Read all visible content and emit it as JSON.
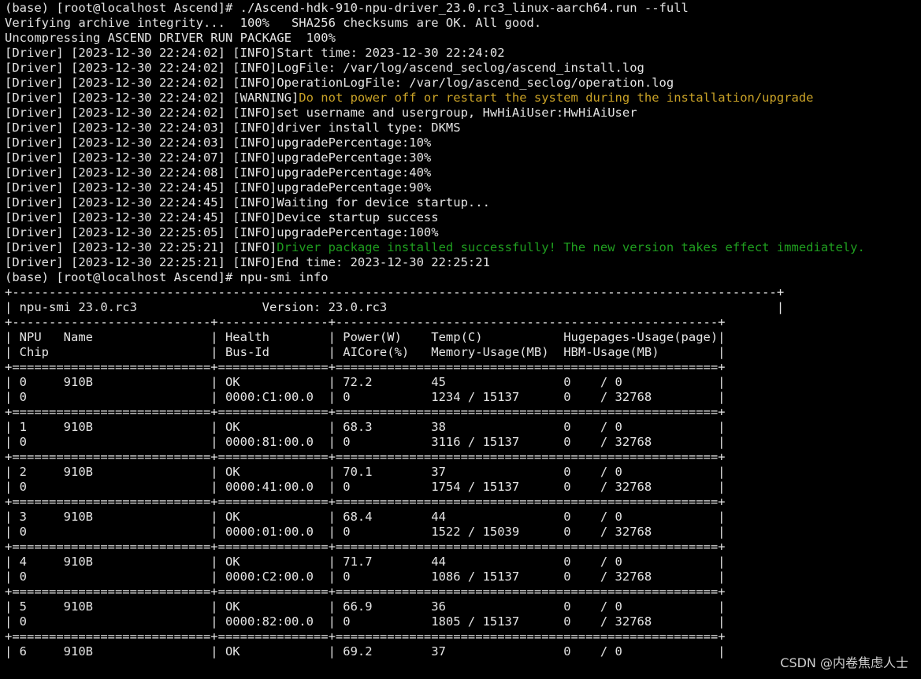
{
  "terminal": {
    "background": "#000000",
    "foreground": "#e4e4e4",
    "warning_color": "#c9a227",
    "success_color": "#1f9e1f",
    "lines": [
      {
        "segments": [
          {
            "text": "(base) [root@localhost Ascend]# ./Ascend-hdk-910-npu-driver_23.0.rc3_linux-aarch64.run --full",
            "style": "normal"
          }
        ]
      },
      {
        "segments": [
          {
            "text": "Verifying archive integrity...  100%   SHA256 checksums are OK. All good.",
            "style": "normal"
          }
        ]
      },
      {
        "segments": [
          {
            "text": "Uncompressing ASCEND DRIVER RUN PACKAGE  100%",
            "style": "normal"
          }
        ]
      },
      {
        "segments": [
          {
            "text": "[Driver] [2023-12-30 22:24:02] [INFO]Start time: 2023-12-30 22:24:02",
            "style": "normal"
          }
        ]
      },
      {
        "segments": [
          {
            "text": "[Driver] [2023-12-30 22:24:02] [INFO]LogFile: /var/log/ascend_seclog/ascend_install.log",
            "style": "normal"
          }
        ]
      },
      {
        "segments": [
          {
            "text": "[Driver] [2023-12-30 22:24:02] [INFO]OperationLogFile: /var/log/ascend_seclog/operation.log",
            "style": "normal"
          }
        ]
      },
      {
        "segments": [
          {
            "text": "[Driver] [2023-12-30 22:24:02] [WARNING]",
            "style": "normal"
          },
          {
            "text": "Do not power off or restart the system during the installation/upgrade",
            "style": "warn"
          }
        ]
      },
      {
        "segments": [
          {
            "text": "[Driver] [2023-12-30 22:24:02] [INFO]set username and usergroup, HwHiAiUser:HwHiAiUser",
            "style": "normal"
          }
        ]
      },
      {
        "segments": [
          {
            "text": "[Driver] [2023-12-30 22:24:03] [INFO]driver install type: DKMS",
            "style": "normal"
          }
        ]
      },
      {
        "segments": [
          {
            "text": "[Driver] [2023-12-30 22:24:03] [INFO]upgradePercentage:10%",
            "style": "normal"
          }
        ]
      },
      {
        "segments": [
          {
            "text": "[Driver] [2023-12-30 22:24:07] [INFO]upgradePercentage:30%",
            "style": "normal"
          }
        ]
      },
      {
        "segments": [
          {
            "text": "[Driver] [2023-12-30 22:24:08] [INFO]upgradePercentage:40%",
            "style": "normal"
          }
        ]
      },
      {
        "segments": [
          {
            "text": "[Driver] [2023-12-30 22:24:45] [INFO]upgradePercentage:90%",
            "style": "normal"
          }
        ]
      },
      {
        "segments": [
          {
            "text": "[Driver] [2023-12-30 22:24:45] [INFO]Waiting for device startup...",
            "style": "normal"
          }
        ]
      },
      {
        "segments": [
          {
            "text": "[Driver] [2023-12-30 22:24:45] [INFO]Device startup success",
            "style": "normal"
          }
        ]
      },
      {
        "segments": [
          {
            "text": "[Driver] [2023-12-30 22:25:05] [INFO]upgradePercentage:100%",
            "style": "normal"
          }
        ]
      },
      {
        "segments": [
          {
            "text": "[Driver] [2023-12-30 22:25:21] [INFO]",
            "style": "normal"
          },
          {
            "text": "Driver package installed successfully! The new version takes effect immediately.",
            "style": "ok"
          }
        ]
      },
      {
        "segments": [
          {
            "text": "[Driver] [2023-12-30 22:25:21] [INFO]End time: 2023-12-30 22:25:21",
            "style": "normal"
          }
        ]
      },
      {
        "segments": [
          {
            "text": "(base) [root@localhost Ascend]# npu-smi info",
            "style": "normal"
          }
        ]
      },
      {
        "segments": [
          {
            "text": "+--------------------------------------------------------------------------------------------------------+",
            "style": "normal"
          }
        ]
      },
      {
        "segments": [
          {
            "text": "| npu-smi 23.0.rc3                 Version: 23.0.rc3                                                     |",
            "style": "normal"
          }
        ]
      },
      {
        "segments": [
          {
            "text": "+---------------------------+---------------+----------------------------------------------------+",
            "style": "normal"
          }
        ]
      },
      {
        "segments": [
          {
            "text": "| NPU   Name                | Health        | Power(W)    Temp(C)           Hugepages-Usage(page)|",
            "style": "normal"
          }
        ]
      },
      {
        "segments": [
          {
            "text": "| Chip                      | Bus-Id        | AICore(%)   Memory-Usage(MB)  HBM-Usage(MB)        |",
            "style": "normal"
          }
        ]
      },
      {
        "segments": [
          {
            "text": "+===========================+===============+====================================================+",
            "style": "normal"
          }
        ]
      },
      {
        "segments": [
          {
            "text": "| 0     910B                | OK            | 72.2        45                0    / 0             |",
            "style": "normal"
          }
        ]
      },
      {
        "segments": [
          {
            "text": "| 0                         | 0000:C1:00.0  | 0           1234 / 15137      0    / 32768         |",
            "style": "normal"
          }
        ]
      },
      {
        "segments": [
          {
            "text": "+===========================+===============+====================================================+",
            "style": "normal"
          }
        ]
      },
      {
        "segments": [
          {
            "text": "| 1     910B                | OK            | 68.3        38                0    / 0             |",
            "style": "normal"
          }
        ]
      },
      {
        "segments": [
          {
            "text": "| 0                         | 0000:81:00.0  | 0           3116 / 15137      0    / 32768         |",
            "style": "normal"
          }
        ]
      },
      {
        "segments": [
          {
            "text": "+===========================+===============+====================================================+",
            "style": "normal"
          }
        ]
      },
      {
        "segments": [
          {
            "text": "| 2     910B                | OK            | 70.1        37                0    / 0             |",
            "style": "normal"
          }
        ]
      },
      {
        "segments": [
          {
            "text": "| 0                         | 0000:41:00.0  | 0           1754 / 15137      0    / 32768         |",
            "style": "normal"
          }
        ]
      },
      {
        "segments": [
          {
            "text": "+===========================+===============+====================================================+",
            "style": "normal"
          }
        ]
      },
      {
        "segments": [
          {
            "text": "| 3     910B                | OK            | 68.4        44                0    / 0             |",
            "style": "normal"
          }
        ]
      },
      {
        "segments": [
          {
            "text": "| 0                         | 0000:01:00.0  | 0           1522 / 15039      0    / 32768         |",
            "style": "normal"
          }
        ]
      },
      {
        "segments": [
          {
            "text": "+===========================+===============+====================================================+",
            "style": "normal"
          }
        ]
      },
      {
        "segments": [
          {
            "text": "| 4     910B                | OK            | 71.7        44                0    / 0             |",
            "style": "normal"
          }
        ]
      },
      {
        "segments": [
          {
            "text": "| 0                         | 0000:C2:00.0  | 0           1086 / 15137      0    / 32768         |",
            "style": "normal"
          }
        ]
      },
      {
        "segments": [
          {
            "text": "+===========================+===============+====================================================+",
            "style": "normal"
          }
        ]
      },
      {
        "segments": [
          {
            "text": "| 5     910B                | OK            | 66.9        36                0    / 0             |",
            "style": "normal"
          }
        ]
      },
      {
        "segments": [
          {
            "text": "| 0                         | 0000:82:00.0  | 0           1805 / 15137      0    / 32768         |",
            "style": "normal"
          }
        ]
      },
      {
        "segments": [
          {
            "text": "+===========================+===============+====================================================+",
            "style": "normal"
          }
        ]
      },
      {
        "segments": [
          {
            "text": "| 6     910B                | OK            | 69.2        37                0    / 0             |",
            "style": "normal"
          }
        ]
      }
    ]
  },
  "watermark": {
    "text": "CSDN @内卷焦虑人士"
  }
}
